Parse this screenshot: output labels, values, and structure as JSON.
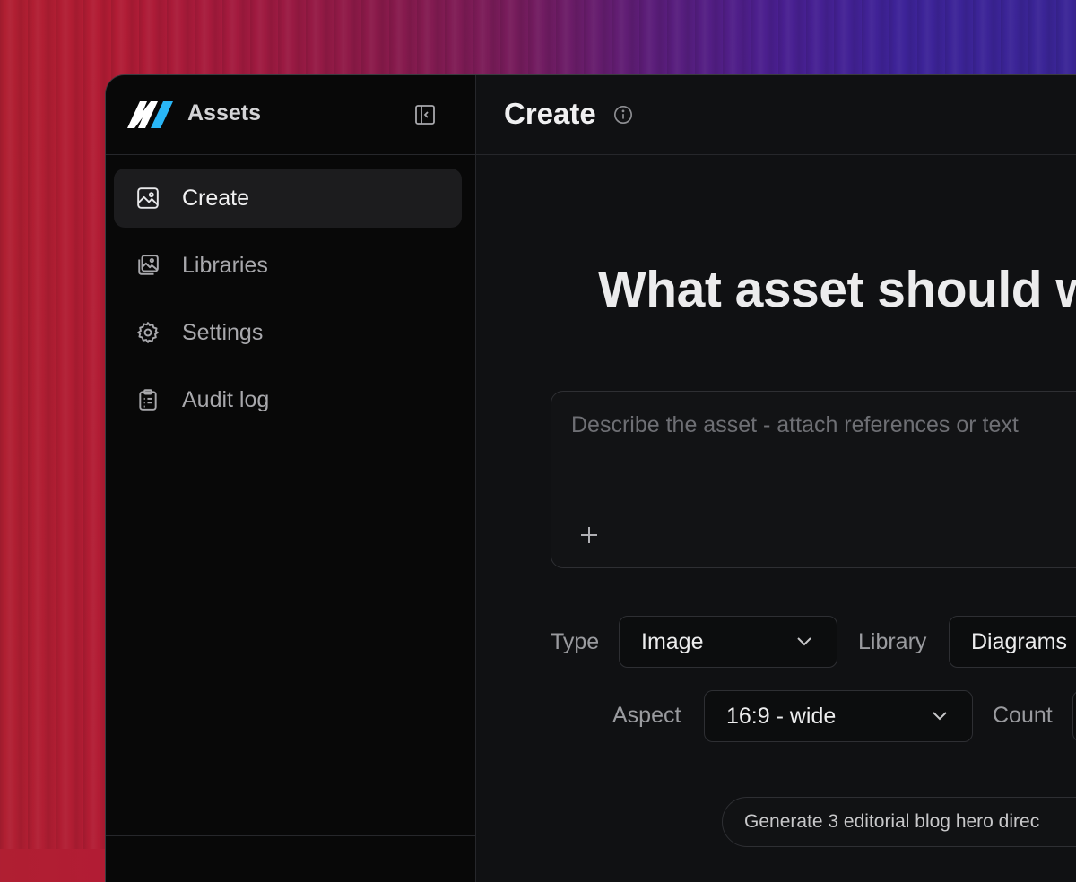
{
  "sidebar": {
    "app_title": "Assets",
    "items": [
      {
        "label": "Create",
        "icon": "image-icon",
        "active": true
      },
      {
        "label": "Libraries",
        "icon": "image-stack-icon",
        "active": false
      },
      {
        "label": "Settings",
        "icon": "gear-icon",
        "active": false
      },
      {
        "label": "Audit log",
        "icon": "clipboard-list-icon",
        "active": false
      }
    ]
  },
  "main": {
    "title": "Create",
    "headline": "What asset should w",
    "prompt": {
      "placeholder": "Describe the asset - attach references or text",
      "value": ""
    },
    "fields": {
      "type_label": "Type",
      "type_value": "Image",
      "library_label": "Library",
      "library_value": "Diagrams",
      "aspect_label": "Aspect",
      "aspect_value": "16:9 - wide",
      "count_label": "Count"
    },
    "suggestion": "Generate 3 editorial blog hero direc"
  },
  "colors": {
    "window_bg": "#101113",
    "sidebar_bg": "#080808",
    "active_item_bg": "#1c1c1e",
    "logo_white": "#ffffff",
    "logo_accent": "#29b6f6"
  }
}
